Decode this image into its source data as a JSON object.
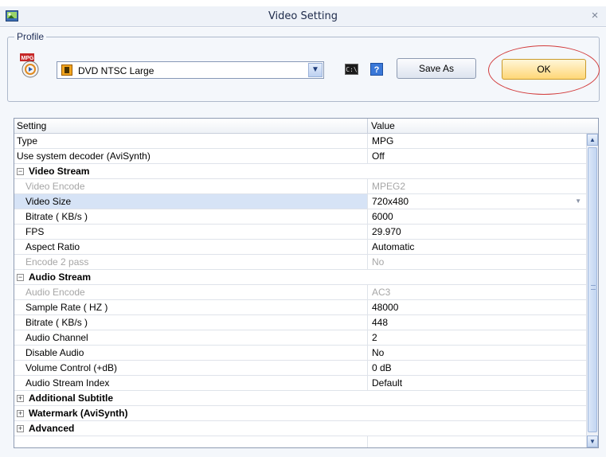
{
  "window": {
    "title": "Video Setting",
    "close_glyph": "×"
  },
  "profile": {
    "legend": "Profile",
    "icon_label": "MPG",
    "selected": "DVD NTSC Large",
    "cmd_icon_label": "C:\\",
    "help_glyph": "?",
    "save_as_label": "Save As",
    "ok_label": "OK"
  },
  "grid": {
    "headers": {
      "setting": "Setting",
      "value": "Value"
    },
    "rows": [
      {
        "setting": "Type",
        "value": "MPG"
      },
      {
        "setting": "Use system decoder (AviSynth)",
        "value": "Off"
      },
      {
        "setting": "Video Stream",
        "value": "",
        "toggle": "−"
      },
      {
        "setting": "Video Encode",
        "value": "MPEG2"
      },
      {
        "setting": "Video Size",
        "value": "720x480"
      },
      {
        "setting": "Bitrate ( KB/s )",
        "value": "6000"
      },
      {
        "setting": "FPS",
        "value": "29.970"
      },
      {
        "setting": "Aspect Ratio",
        "value": "Automatic"
      },
      {
        "setting": "Encode 2 pass",
        "value": "No"
      },
      {
        "setting": "Audio Stream",
        "value": "",
        "toggle": "−"
      },
      {
        "setting": "Audio Encode",
        "value": "AC3"
      },
      {
        "setting": "Sample Rate ( HZ )",
        "value": "48000"
      },
      {
        "setting": "Bitrate ( KB/s )",
        "value": "448"
      },
      {
        "setting": "Audio Channel",
        "value": "2"
      },
      {
        "setting": "Disable Audio",
        "value": "No"
      },
      {
        "setting": "Volume Control (+dB)",
        "value": "0 dB"
      },
      {
        "setting": "Audio Stream Index",
        "value": "Default"
      },
      {
        "setting": "Additional Subtitle",
        "value": "",
        "toggle": "+"
      },
      {
        "setting": "Watermark (AviSynth)",
        "value": "",
        "toggle": "+"
      },
      {
        "setting": "Advanced",
        "value": "",
        "toggle": "+"
      }
    ]
  },
  "icons": {
    "app": "video-app-icon",
    "close": "close-icon",
    "mpg": "mpg-profile-icon",
    "disk": "floppy-disk-icon",
    "dropdown": "chevron-down-icon",
    "cmd": "command-prompt-icon",
    "help": "help-icon"
  },
  "colors": {
    "highlight_circle": "#d23b3b",
    "ok_button": "#ffd777",
    "selected_row": "#d6e3f6"
  }
}
